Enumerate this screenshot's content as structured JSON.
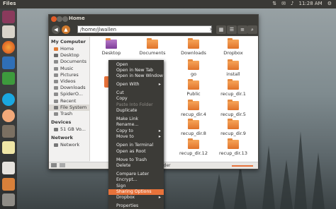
{
  "top_panel": {
    "app_name": "Files",
    "time": "11:28 AM"
  },
  "window": {
    "title": "Home",
    "path": "/home/jlwallen",
    "status_text": "lder"
  },
  "sidebar": {
    "sections": [
      {
        "title": "My Computer",
        "items": [
          "Home",
          "Desktop",
          "Documents",
          "Music",
          "Pictures",
          "Videos",
          "Downloads",
          "SpiderO...",
          "Recent",
          "File System",
          "Trash"
        ]
      },
      {
        "title": "Devices",
        "items": [
          "51 GB Vo..."
        ]
      },
      {
        "title": "Network",
        "items": [
          "Network"
        ]
      }
    ]
  },
  "icons": [
    {
      "label": "Desktop"
    },
    {
      "label": "Documents"
    },
    {
      "label": "Downloads"
    },
    {
      "label": "Dropbox"
    },
    {
      "label": "go"
    },
    {
      "label": "install"
    },
    {
      "label": "Public"
    },
    {
      "label": "recup_dir.1"
    },
    {
      "label": "recup_dir.4"
    },
    {
      "label": "recup_dir.5"
    },
    {
      "label": "recup_dir.8"
    },
    {
      "label": "recup_dir.9"
    },
    {
      "label": "recup_dir.12"
    },
    {
      "label": "recup_dir.13"
    }
  ],
  "context_menu": {
    "items": [
      "Open",
      "Open in New Tab",
      "Open in New Window",
      "Open With",
      "Cut",
      "Copy",
      "Paste Into Folder",
      "Duplicate",
      "Make Link",
      "Rename...",
      "Copy to",
      "Move to",
      "Open in Terminal",
      "Open as Root",
      "Move to Trash",
      "Delete",
      "Compare Later",
      "Encrypt...",
      "Sign",
      "Sharing Options",
      "Dropbox",
      "Properties"
    ]
  }
}
